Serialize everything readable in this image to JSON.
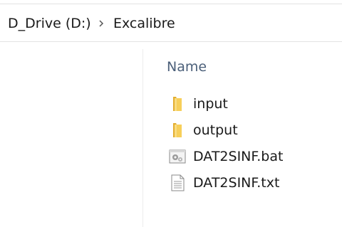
{
  "breadcrumb": {
    "drive": "D_Drive (D:)",
    "separator_icon": "chevron-right-icon",
    "folder": "Excalibre"
  },
  "columns": {
    "name_header": "Name"
  },
  "files": [
    {
      "name": "input",
      "icon": "folder-icon"
    },
    {
      "name": "output",
      "icon": "folder-icon"
    },
    {
      "name": "DAT2SINF.bat",
      "icon": "batch-file-icon"
    },
    {
      "name": "DAT2SINF.txt",
      "icon": "text-file-icon"
    }
  ],
  "colors": {
    "folder": "#f4c94e",
    "header_text": "#4c607a",
    "text": "#1a1a1a"
  }
}
